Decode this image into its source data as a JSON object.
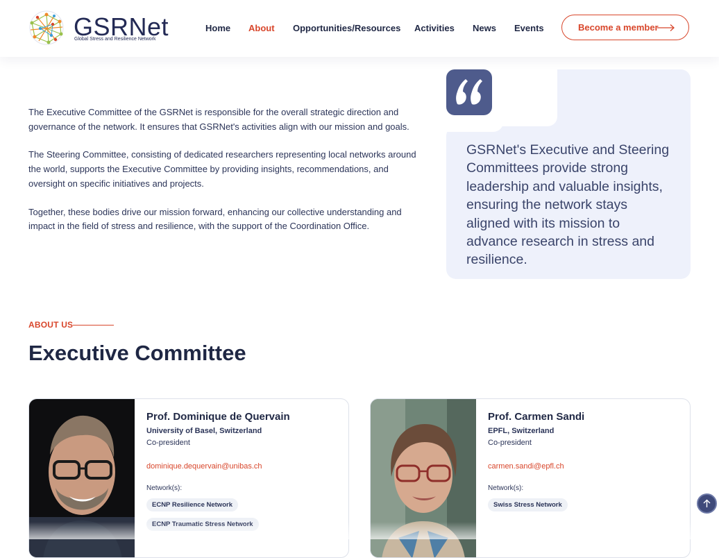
{
  "header": {
    "logo_name": "GSRNet",
    "logo_tagline": "Global Stress and Resilience Network",
    "nav": [
      {
        "label": "Home",
        "active": false
      },
      {
        "label": "About",
        "active": true
      },
      {
        "label": "Opportunities/Resources",
        "active": false
      },
      {
        "label": "Activities",
        "active": false
      },
      {
        "label": "News",
        "active": false
      },
      {
        "label": "Events",
        "active": false
      }
    ],
    "cta_label": "Become a member",
    "accent_color": "#d8462b",
    "brand_color": "#232a55"
  },
  "intro": {
    "paragraphs": [
      "The Executive Committee of the GSRNet is responsible for the overall strategic direction and governance of the network. It ensures that GSRNet's activities align with our mission and goals.",
      "The Steering Committee, consisting of dedicated researchers representing local networks around the world, supports the Executive Committee by providing insights, recommendations, and oversight on specific initiatives and projects.",
      "Together, these bodies drive our mission forward, enhancing our collective understanding and impact in the field of stress and resilience, with the support of the Coordination Office."
    ]
  },
  "quote": {
    "icon": "quote-mark-icon",
    "text": "GSRNet's Executive and Steering Committees provide strong leadership and valuable insights, ensuring the network stays aligned with its mission to advance research in stress and resilience."
  },
  "about": {
    "label": "ABOUT US",
    "title": "Executive Committee"
  },
  "members": [
    {
      "name": "Prof. Dominique de Quervain",
      "affiliation": "University of Basel, Switzerland",
      "role": "Co-president",
      "email": "dominique.dequervain@unibas.ch",
      "networks_label": "Network(s):",
      "networks": [
        "ECNP Resilience Network",
        "ECNP Traumatic Stress Network"
      ]
    },
    {
      "name": "Prof. Carmen Sandi",
      "affiliation": "EPFL, Switzerland",
      "role": "Co-president",
      "email": "carmen.sandi@epfl.ch",
      "networks_label": "Network(s):",
      "networks": [
        "Swiss Stress Network"
      ]
    }
  ],
  "scroll_top_icon": "arrow-up-icon"
}
